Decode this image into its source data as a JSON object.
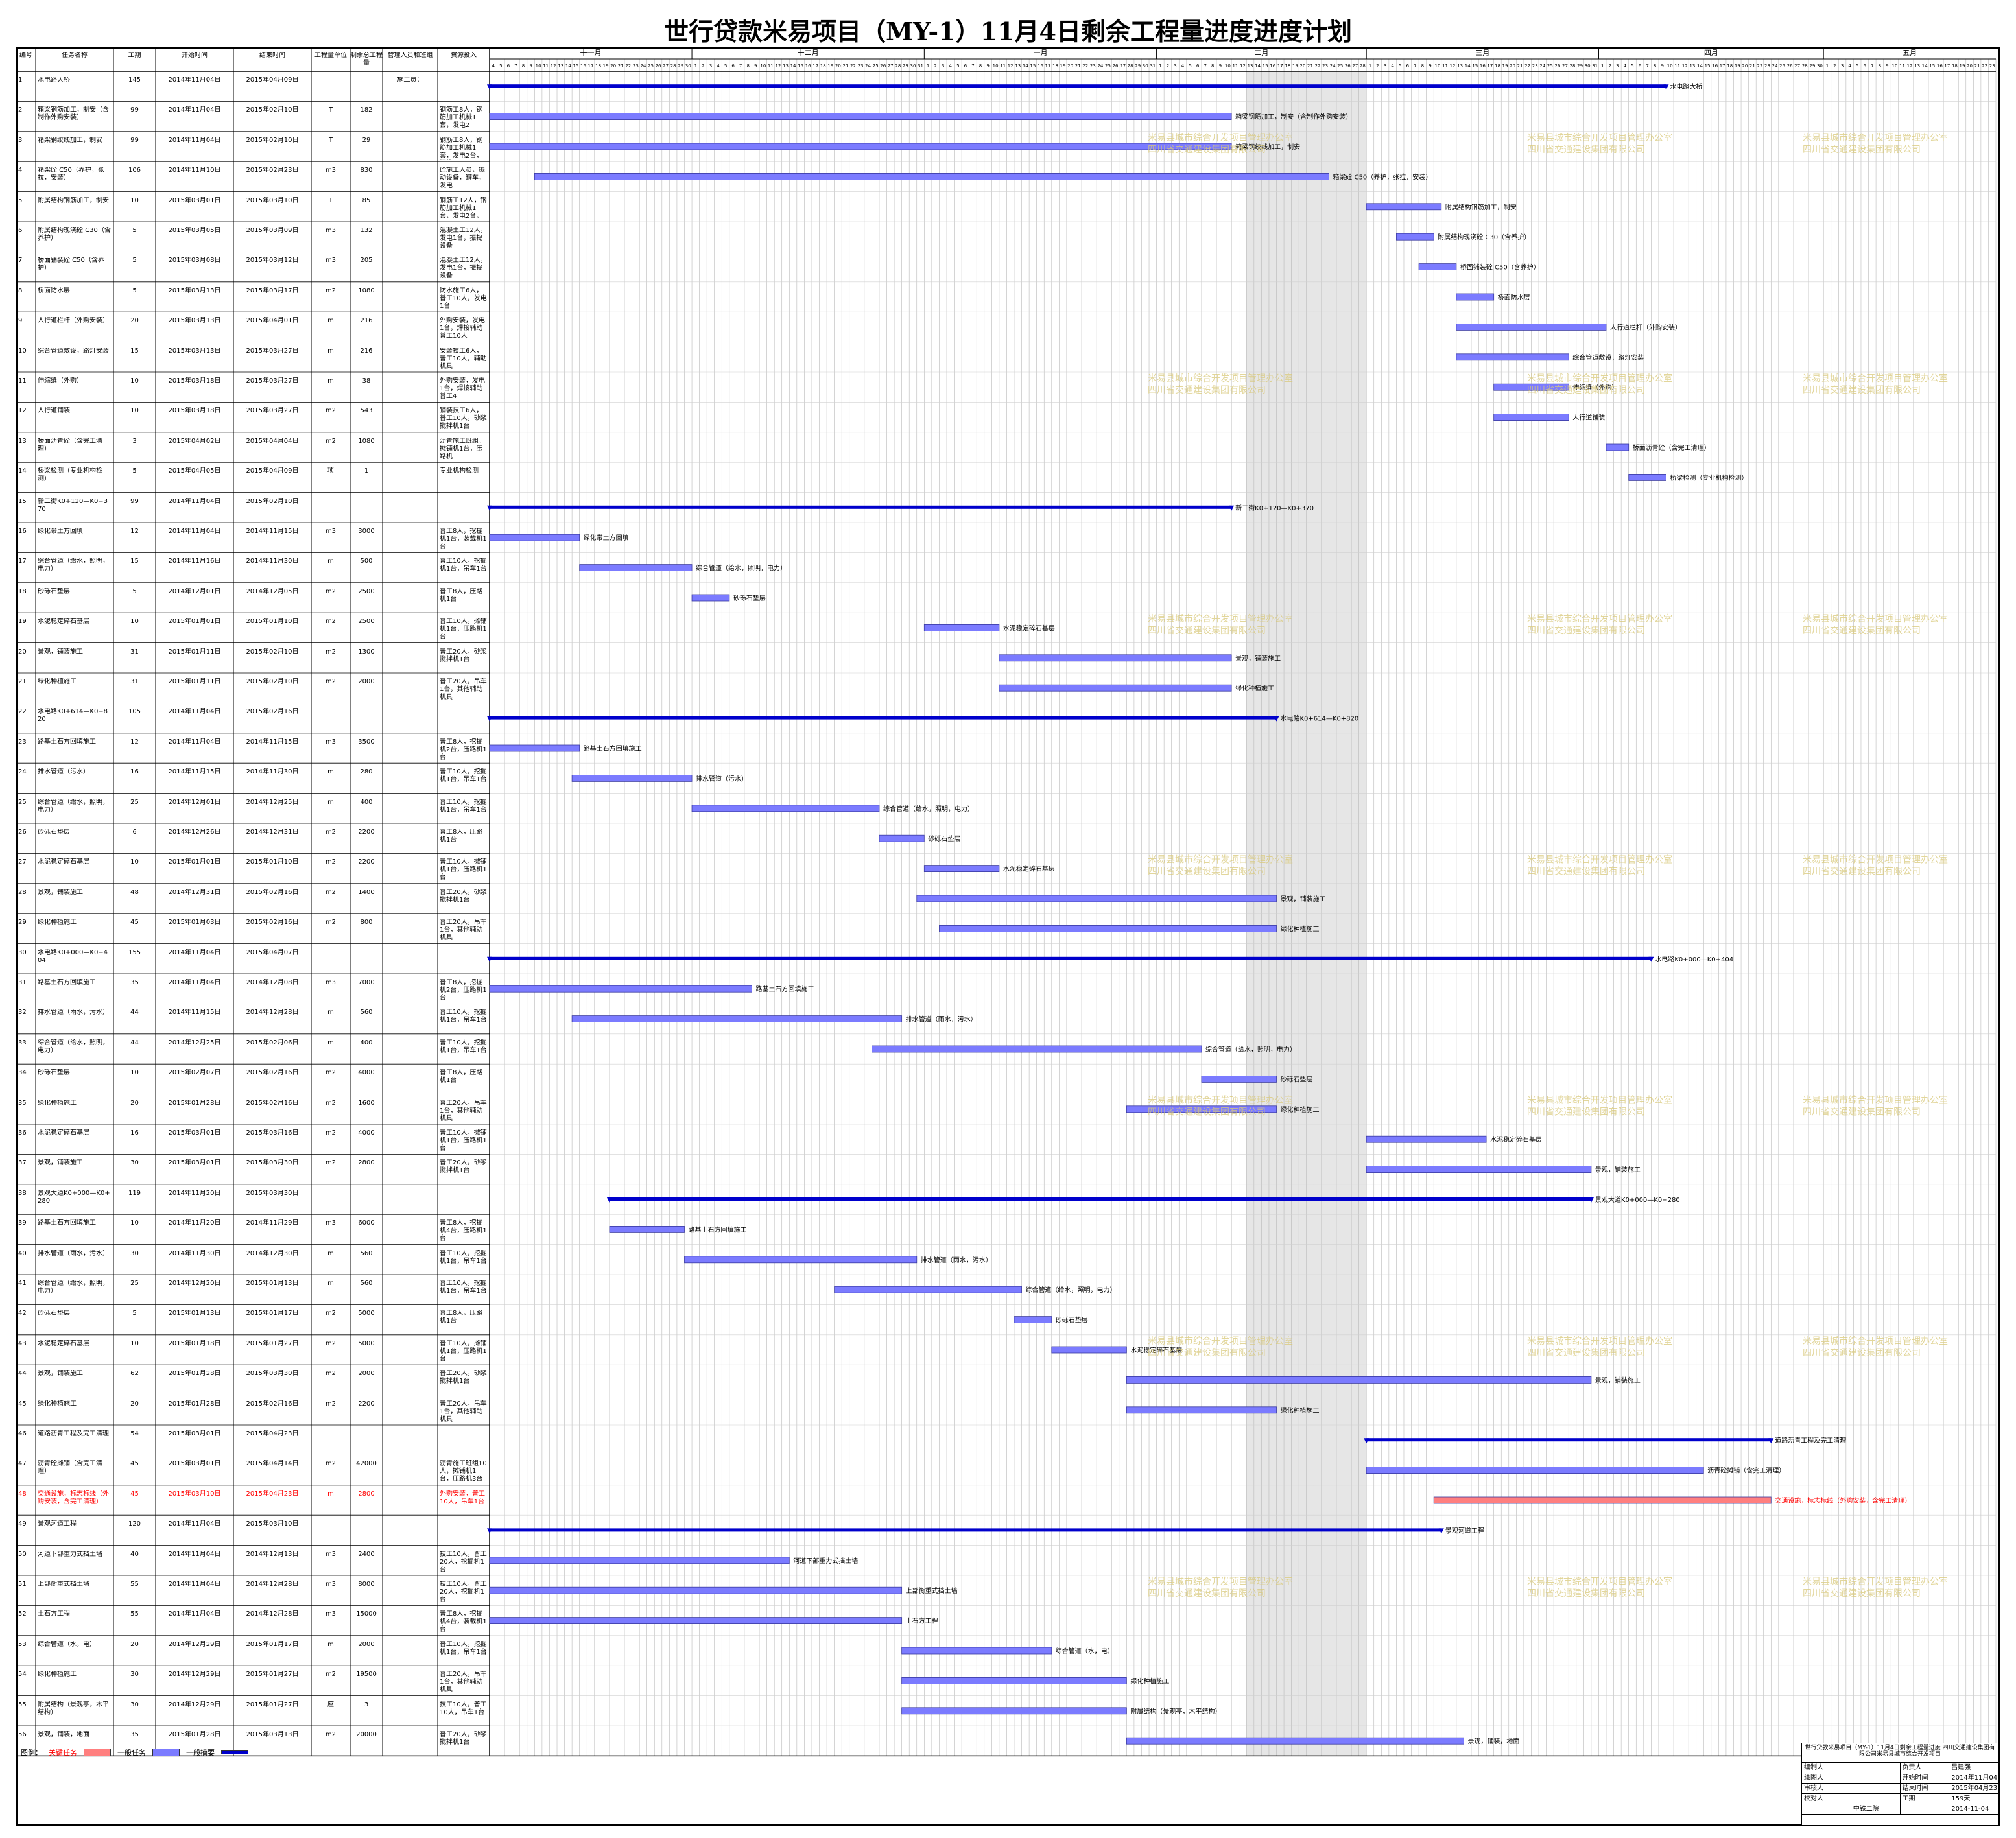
{
  "title": "世行贷款米易项目（MY-1）11月4日剩余工程量进度进度计划",
  "columns": [
    "编号",
    "任务名称",
    "工期",
    "开始时间",
    "结束时间",
    "工程量单位",
    "剩余总工程量",
    "管理人员和班组",
    "资源投入"
  ],
  "months": [
    "十一月",
    "十二月",
    "一月",
    "二月",
    "三月",
    "四月",
    "五月"
  ],
  "legend": {
    "label": "图例：",
    "critical": "关键任务",
    "normal": "一般任务",
    "summary": "一般摘要",
    "colors": {
      "critical": "#ff7f7f",
      "normal": "#7b7bff",
      "summary": "#0000cc"
    }
  },
  "watermark": [
    "米易县城市综合开发项目管理办公室",
    "四川省交通建设集团有限公司"
  ],
  "tasks": [
    {
      "id": "1",
      "name": "水电路大桥",
      "dur": "145",
      "start": "2014年11月04日",
      "end": "2015年04月09日",
      "unit": "",
      "qty": "",
      "mgmt": "施工员：",
      "res": "",
      "summary": true,
      "bar": "水电路大桥"
    },
    {
      "id": "2",
      "name": "箱梁钢筋加工，制安（含制作外购安装）",
      "dur": "99",
      "start": "2014年11月04日",
      "end": "2015年02月10日",
      "unit": "T",
      "qty": "182",
      "mgmt": "",
      "res": "钢筋工8人，钢筋加工机械1套，发电2",
      "bar": "箱梁钢筋加工，制安（含制作外购安装）"
    },
    {
      "id": "3",
      "name": "箱梁钢绞线加工，制安",
      "dur": "99",
      "start": "2014年11月04日",
      "end": "2015年02月10日",
      "unit": "T",
      "qty": "29",
      "mgmt": "",
      "res": "钢筋工8人，钢筋加工机械1套，发电2台，钢筋45T",
      "bar": "箱梁钢绞线加工，制安"
    },
    {
      "id": "4",
      "name": "箱梁砼 C50（养护，张拉，安装）",
      "dur": "106",
      "start": "2014年11月10日",
      "end": "2015年02月23日",
      "unit": "m3",
      "qty": "830",
      "mgmt": "",
      "res": "砼施工人员，振动设备，罐车，发电",
      "bar": "箱梁砼 C50（养护，张拉，安装）"
    },
    {
      "id": "5",
      "name": "附属结构钢筋加工，制安",
      "dur": "10",
      "start": "2015年03月01日",
      "end": "2015年03月10日",
      "unit": "T",
      "qty": "85",
      "mgmt": "",
      "res": "钢筋工12人，钢筋加工机械1套，发电2台，钢筋45T",
      "bar": "附属结构钢筋加工，制安"
    },
    {
      "id": "6",
      "name": "附属结构现浇砼 C30（含养护）",
      "dur": "5",
      "start": "2015年03月05日",
      "end": "2015年03月09日",
      "unit": "m3",
      "qty": "132",
      "mgmt": "",
      "res": "混凝土工12人，发电1台，振捣设备",
      "bar": "附属结构现浇砼 C30（含养护）"
    },
    {
      "id": "7",
      "name": "桥面铺装砼 C50（含养护）",
      "dur": "5",
      "start": "2015年03月08日",
      "end": "2015年03月12日",
      "unit": "m3",
      "qty": "205",
      "mgmt": "",
      "res": "混凝土工12人，发电1台，振捣设备",
      "bar": "桥面铺装砼 C50（含养护）"
    },
    {
      "id": "8",
      "name": "桥面防水层",
      "dur": "5",
      "start": "2015年03月13日",
      "end": "2015年03月17日",
      "unit": "m2",
      "qty": "1080",
      "mgmt": "",
      "res": "防水施工6人，普工10人，发电1台",
      "bar": "桥面防水层"
    },
    {
      "id": "9",
      "name": "人行道栏杆（外购安装）",
      "dur": "20",
      "start": "2015年03月13日",
      "end": "2015年04月01日",
      "unit": "m",
      "qty": "216",
      "mgmt": "",
      "res": "外购安装，发电1台，焊接辅助普工10人",
      "bar": "人行道栏杆（外购安装）"
    },
    {
      "id": "10",
      "name": "综合管道敷设，路灯安装",
      "dur": "15",
      "start": "2015年03月13日",
      "end": "2015年03月27日",
      "unit": "m",
      "qty": "216",
      "mgmt": "",
      "res": "安装技工6人，普工10人，辅助机具",
      "bar": "综合管道敷设，路灯安装"
    },
    {
      "id": "11",
      "name": "伸缩缝（外购）",
      "dur": "10",
      "start": "2015年03月18日",
      "end": "2015年03月27日",
      "unit": "m",
      "qty": "38",
      "mgmt": "",
      "res": "外购安装，发电1台，焊接辅助普工4",
      "bar": "伸缩缝（外购）"
    },
    {
      "id": "12",
      "name": "人行道铺装",
      "dur": "10",
      "start": "2015年03月18日",
      "end": "2015年03月27日",
      "unit": "m2",
      "qty": "543",
      "mgmt": "",
      "res": "铺装技工6人，普工10人，砂浆搅拌机1台",
      "bar": "人行道铺装"
    },
    {
      "id": "13",
      "name": "桥面沥青砼（含完工清理）",
      "dur": "3",
      "start": "2015年04月02日",
      "end": "2015年04月04日",
      "unit": "m2",
      "qty": "1080",
      "mgmt": "",
      "res": "沥青施工班组，摊铺机1台，压路机",
      "bar": "桥面沥青砼（含完工清理）"
    },
    {
      "id": "14",
      "name": "桥梁检测（专业机构检测）",
      "dur": "5",
      "start": "2015年04月05日",
      "end": "2015年04月09日",
      "unit": "项",
      "qty": "1",
      "mgmt": "",
      "res": "专业机构检测",
      "bar": "桥梁检测（专业机构检测）"
    },
    {
      "id": "15",
      "name": "新二街K0+120—K0+370",
      "dur": "99",
      "start": "2014年11月04日",
      "end": "2015年02月10日",
      "unit": "",
      "qty": "",
      "mgmt": "",
      "res": "",
      "summary": true,
      "bar": "新二街K0+120—K0+370"
    },
    {
      "id": "16",
      "name": "绿化带土方回填",
      "dur": "12",
      "start": "2014年11月04日",
      "end": "2014年11月15日",
      "unit": "m3",
      "qty": "3000",
      "mgmt": "",
      "res": "普工8人，挖掘机1台，装载机1台",
      "bar": "绿化带土方回填"
    },
    {
      "id": "17",
      "name": "综合管道（给水，照明，电力）",
      "dur": "15",
      "start": "2014年11月16日",
      "end": "2014年11月30日",
      "unit": "m",
      "qty": "500",
      "mgmt": "",
      "res": "普工10人，挖掘机1台，吊车1台",
      "bar": "综合管道（给水，照明，电力）"
    },
    {
      "id": "18",
      "name": "砂砾石垫层",
      "dur": "5",
      "start": "2014年12月01日",
      "end": "2014年12月05日",
      "unit": "m2",
      "qty": "2500",
      "mgmt": "",
      "res": "普工8人，压路机1台",
      "bar": "砂砾石垫层"
    },
    {
      "id": "19",
      "name": "水泥稳定碎石基层",
      "dur": "10",
      "start": "2015年01月01日",
      "end": "2015年01月10日",
      "unit": "m2",
      "qty": "2500",
      "mgmt": "",
      "res": "普工10人，摊铺机1台，压路机1台",
      "bar": "水泥稳定碎石基层"
    },
    {
      "id": "20",
      "name": "景观，铺装施工",
      "dur": "31",
      "start": "2015年01月11日",
      "end": "2015年02月10日",
      "unit": "m2",
      "qty": "1300",
      "mgmt": "",
      "res": "普工20人，砂浆搅拌机1台",
      "bar": "景观，铺装施工"
    },
    {
      "id": "21",
      "name": "绿化种植施工",
      "dur": "31",
      "start": "2015年01月11日",
      "end": "2015年02月10日",
      "unit": "m2",
      "qty": "2000",
      "mgmt": "",
      "res": "普工20人，吊车1台，其他辅助机具",
      "bar": "绿化种植施工"
    },
    {
      "id": "22",
      "name": "水电路K0+614—K0+820",
      "dur": "105",
      "start": "2014年11月04日",
      "end": "2015年02月16日",
      "unit": "",
      "qty": "",
      "mgmt": "",
      "res": "",
      "summary": true,
      "bar": "水电路K0+614—K0+820"
    },
    {
      "id": "23",
      "name": "路基土石方回填施工",
      "dur": "12",
      "start": "2014年11月04日",
      "end": "2014年11月15日",
      "unit": "m3",
      "qty": "3500",
      "mgmt": "",
      "res": "普工8人，挖掘机2台，压路机1台",
      "bar": "路基土石方回填施工"
    },
    {
      "id": "24",
      "name": "排水管道（污水）",
      "dur": "16",
      "start": "2014年11月15日",
      "end": "2014年11月30日",
      "unit": "m",
      "qty": "280",
      "mgmt": "",
      "res": "普工10人，挖掘机1台，吊车1台",
      "bar": "排水管道（污水）"
    },
    {
      "id": "25",
      "name": "综合管道（给水，照明，电力）",
      "dur": "25",
      "start": "2014年12月01日",
      "end": "2014年12月25日",
      "unit": "m",
      "qty": "400",
      "mgmt": "",
      "res": "普工10人，挖掘机1台，吊车1台",
      "bar": "综合管道（给水，照明，电力）"
    },
    {
      "id": "26",
      "name": "砂砾石垫层",
      "dur": "6",
      "start": "2014年12月26日",
      "end": "2014年12月31日",
      "unit": "m2",
      "qty": "2200",
      "mgmt": "",
      "res": "普工8人，压路机1台",
      "bar": "砂砾石垫层"
    },
    {
      "id": "27",
      "name": "水泥稳定碎石基层",
      "dur": "10",
      "start": "2015年01月01日",
      "end": "2015年01月10日",
      "unit": "m2",
      "qty": "2200",
      "mgmt": "",
      "res": "普工10人，摊铺机1台，压路机1台",
      "bar": "水泥稳定碎石基层"
    },
    {
      "id": "28",
      "name": "景观，铺装施工",
      "dur": "48",
      "start": "2014年12月31日",
      "end": "2015年02月16日",
      "unit": "m2",
      "qty": "1400",
      "mgmt": "",
      "res": "普工20人，砂浆搅拌机1台",
      "bar": "景观，铺装施工"
    },
    {
      "id": "29",
      "name": "绿化种植施工",
      "dur": "45",
      "start": "2015年01月03日",
      "end": "2015年02月16日",
      "unit": "m2",
      "qty": "800",
      "mgmt": "",
      "res": "普工20人，吊车1台，其他辅助机具",
      "bar": "绿化种植施工"
    },
    {
      "id": "30",
      "name": "水电路K0+000—K0+404",
      "dur": "155",
      "start": "2014年11月04日",
      "end": "2015年04月07日",
      "unit": "",
      "qty": "",
      "mgmt": "",
      "res": "",
      "summary": true,
      "bar": "水电路K0+000—K0+404"
    },
    {
      "id": "31",
      "name": "路基土石方回填施工",
      "dur": "35",
      "start": "2014年11月04日",
      "end": "2014年12月08日",
      "unit": "m3",
      "qty": "7000",
      "mgmt": "",
      "res": "普工8人，挖掘机2台，压路机1台",
      "bar": "路基土石方回填施工"
    },
    {
      "id": "32",
      "name": "排水管道（雨水，污水）",
      "dur": "44",
      "start": "2014年11月15日",
      "end": "2014年12月28日",
      "unit": "m",
      "qty": "560",
      "mgmt": "",
      "res": "普工10人，挖掘机1台，吊车1台",
      "bar": "排水管道（雨水，污水）"
    },
    {
      "id": "33",
      "name": "综合管道（给水，照明，电力）",
      "dur": "44",
      "start": "2014年12月25日",
      "end": "2015年02月06日",
      "unit": "m",
      "qty": "400",
      "mgmt": "",
      "res": "普工10人，挖掘机1台，吊车1台",
      "bar": "综合管道（给水，照明，电力）"
    },
    {
      "id": "34",
      "name": "砂砾石垫层",
      "dur": "10",
      "start": "2015年02月07日",
      "end": "2015年02月16日",
      "unit": "m2",
      "qty": "4000",
      "mgmt": "",
      "res": "普工8人，压路机1台",
      "bar": "砂砾石垫层"
    },
    {
      "id": "35",
      "name": "绿化种植施工",
      "dur": "20",
      "start": "2015年01月28日",
      "end": "2015年02月16日",
      "unit": "m2",
      "qty": "1600",
      "mgmt": "",
      "res": "普工20人，吊车1台，其他辅助机具",
      "bar": "绿化种植施工"
    },
    {
      "id": "36",
      "name": "水泥稳定碎石基层",
      "dur": "16",
      "start": "2015年03月01日",
      "end": "2015年03月16日",
      "unit": "m2",
      "qty": "4000",
      "mgmt": "",
      "res": "普工10人，摊铺机1台，压路机1台",
      "bar": "水泥稳定碎石基层"
    },
    {
      "id": "37",
      "name": "景观，铺装施工",
      "dur": "30",
      "start": "2015年03月01日",
      "end": "2015年03月30日",
      "unit": "m2",
      "qty": "2800",
      "mgmt": "",
      "res": "普工20人，砂浆搅拌机1台",
      "bar": "景观，铺装施工"
    },
    {
      "id": "38",
      "name": "景观大道K0+000—K0+280",
      "dur": "119",
      "start": "2014年11月20日",
      "end": "2015年03月30日",
      "unit": "",
      "qty": "",
      "mgmt": "",
      "res": "",
      "summary": true,
      "bar": "景观大道K0+000—K0+280"
    },
    {
      "id": "39",
      "name": "路基土石方回填施工",
      "dur": "10",
      "start": "2014年11月20日",
      "end": "2014年11月29日",
      "unit": "m3",
      "qty": "6000",
      "mgmt": "",
      "res": "普工8人，挖掘机4台，压路机1台",
      "bar": "路基土石方回填施工"
    },
    {
      "id": "40",
      "name": "排水管道（雨水，污水）",
      "dur": "30",
      "start": "2014年11月30日",
      "end": "2014年12月30日",
      "unit": "m",
      "qty": "560",
      "mgmt": "",
      "res": "普工10人，挖掘机1台，吊车1台",
      "bar": "排水管道（雨水，污水）"
    },
    {
      "id": "41",
      "name": "综合管道（给水，照明，电力）",
      "dur": "25",
      "start": "2014年12月20日",
      "end": "2015年01月13日",
      "unit": "m",
      "qty": "560",
      "mgmt": "",
      "res": "普工10人，挖掘机1台，吊车1台",
      "bar": "综合管道（给水，照明，电力）"
    },
    {
      "id": "42",
      "name": "砂砾石垫层",
      "dur": "5",
      "start": "2015年01月13日",
      "end": "2015年01月17日",
      "unit": "m2",
      "qty": "5000",
      "mgmt": "",
      "res": "普工8人，压路机1台",
      "bar": "砂砾石垫层"
    },
    {
      "id": "43",
      "name": "水泥稳定碎石基层",
      "dur": "10",
      "start": "2015年01月18日",
      "end": "2015年01月27日",
      "unit": "m2",
      "qty": "5000",
      "mgmt": "",
      "res": "普工10人，摊铺机1台，压路机1台",
      "bar": "水泥稳定碎石基层"
    },
    {
      "id": "44",
      "name": "景观，铺装施工",
      "dur": "62",
      "start": "2015年01月28日",
      "end": "2015年03月30日",
      "unit": "m2",
      "qty": "2000",
      "mgmt": "",
      "res": "普工20人，砂浆搅拌机1台",
      "bar": "景观，铺装施工"
    },
    {
      "id": "45",
      "name": "绿化种植施工",
      "dur": "20",
      "start": "2015年01月28日",
      "end": "2015年02月16日",
      "unit": "m2",
      "qty": "2200",
      "mgmt": "",
      "res": "普工20人，吊车1台，其他辅助机具",
      "bar": "绿化种植施工"
    },
    {
      "id": "46",
      "name": "道路沥青工程及完工清理",
      "dur": "54",
      "start": "2015年03月01日",
      "end": "2015年04月23日",
      "unit": "",
      "qty": "",
      "mgmt": "",
      "res": "",
      "summary": true,
      "bar": "道路沥青工程及完工清理"
    },
    {
      "id": "47",
      "name": "沥青砼摊铺（含完工清理）",
      "dur": "45",
      "start": "2015年03月01日",
      "end": "2015年04月14日",
      "unit": "m2",
      "qty": "42000",
      "mgmt": "",
      "res": "沥青施工班组10人，摊铺机1台，压路机3台",
      "bar": "沥青砼摊铺（含完工清理）"
    },
    {
      "id": "48",
      "name": "交通设施，标志标线（外购安装，含完工清理）",
      "dur": "45",
      "start": "2015年03月10日",
      "end": "2015年04月23日",
      "unit": "m",
      "qty": "2800",
      "mgmt": "",
      "res": "外购安装，普工10人，吊车1台",
      "critical": true,
      "bar": "交通设施，标志标线（外购安装，含完工清理）"
    },
    {
      "id": "49",
      "name": "景观河道工程",
      "dur": "120",
      "start": "2014年11月04日",
      "end": "2015年03月10日",
      "unit": "",
      "qty": "",
      "mgmt": "",
      "res": "",
      "summary": true,
      "bar": "景观河道工程"
    },
    {
      "id": "50",
      "name": "河道下部重力式挡土墙",
      "dur": "40",
      "start": "2014年11月04日",
      "end": "2014年12月13日",
      "unit": "m3",
      "qty": "2400",
      "mgmt": "",
      "res": "技工10人，普工20人，挖掘机1台",
      "bar": "河道下部重力式挡土墙"
    },
    {
      "id": "51",
      "name": "上部衡重式挡土墙",
      "dur": "55",
      "start": "2014年11月04日",
      "end": "2014年12月28日",
      "unit": "m3",
      "qty": "8000",
      "mgmt": "",
      "res": "技工10人，普工20人，挖掘机1台",
      "bar": "上部衡重式挡土墙"
    },
    {
      "id": "52",
      "name": "土石方工程",
      "dur": "55",
      "start": "2014年11月04日",
      "end": "2014年12月28日",
      "unit": "m3",
      "qty": "15000",
      "mgmt": "",
      "res": "普工8人，挖掘机4台，装载机1台",
      "bar": "土石方工程"
    },
    {
      "id": "53",
      "name": "综合管道（水，电）",
      "dur": "20",
      "start": "2014年12月29日",
      "end": "2015年01月17日",
      "unit": "m",
      "qty": "2000",
      "mgmt": "",
      "res": "普工10人，挖掘机1台，吊车1台",
      "bar": "综合管道（水，电）"
    },
    {
      "id": "54",
      "name": "绿化种植施工",
      "dur": "30",
      "start": "2014年12月29日",
      "end": "2015年01月27日",
      "unit": "m2",
      "qty": "19500",
      "mgmt": "",
      "res": "普工20人，吊车1台，其他辅助机具",
      "bar": "绿化种植施工"
    },
    {
      "id": "55",
      "name": "附属结构（景观亭，木平结构）",
      "dur": "30",
      "start": "2014年12月29日",
      "end": "2015年01月27日",
      "unit": "座",
      "qty": "3",
      "mgmt": "",
      "res": "技工10人，普工10人，吊车1台",
      "bar": "附属结构（景观亭，木平结构）"
    },
    {
      "id": "56",
      "name": "景观，铺装，地面",
      "dur": "35",
      "start": "2015年01月28日",
      "end": "2015年03月13日",
      "unit": "m2",
      "qty": "20000",
      "mgmt": "",
      "res": "普工20人，砂浆搅拌机1台",
      "bar": "景观，铺装，地面"
    }
  ],
  "titleblock": {
    "header": "世行贷款米易项目（MY-1）11月4日剩余工程量进度 四川交通建设集团有限公司米易县城市综合开发项目",
    "rows": [
      [
        "编制人",
        "",
        "负责人",
        "吕建强"
      ],
      [
        "绘图人",
        "",
        "开始时间",
        "2014年11月04日"
      ],
      [
        "审核人",
        "",
        "结束时间",
        "2015年04月23日"
      ],
      [
        "校对人",
        "",
        "工期",
        "159天"
      ],
      [
        "",
        "中铁二院",
        "",
        "2014-11-04"
      ]
    ]
  }
}
